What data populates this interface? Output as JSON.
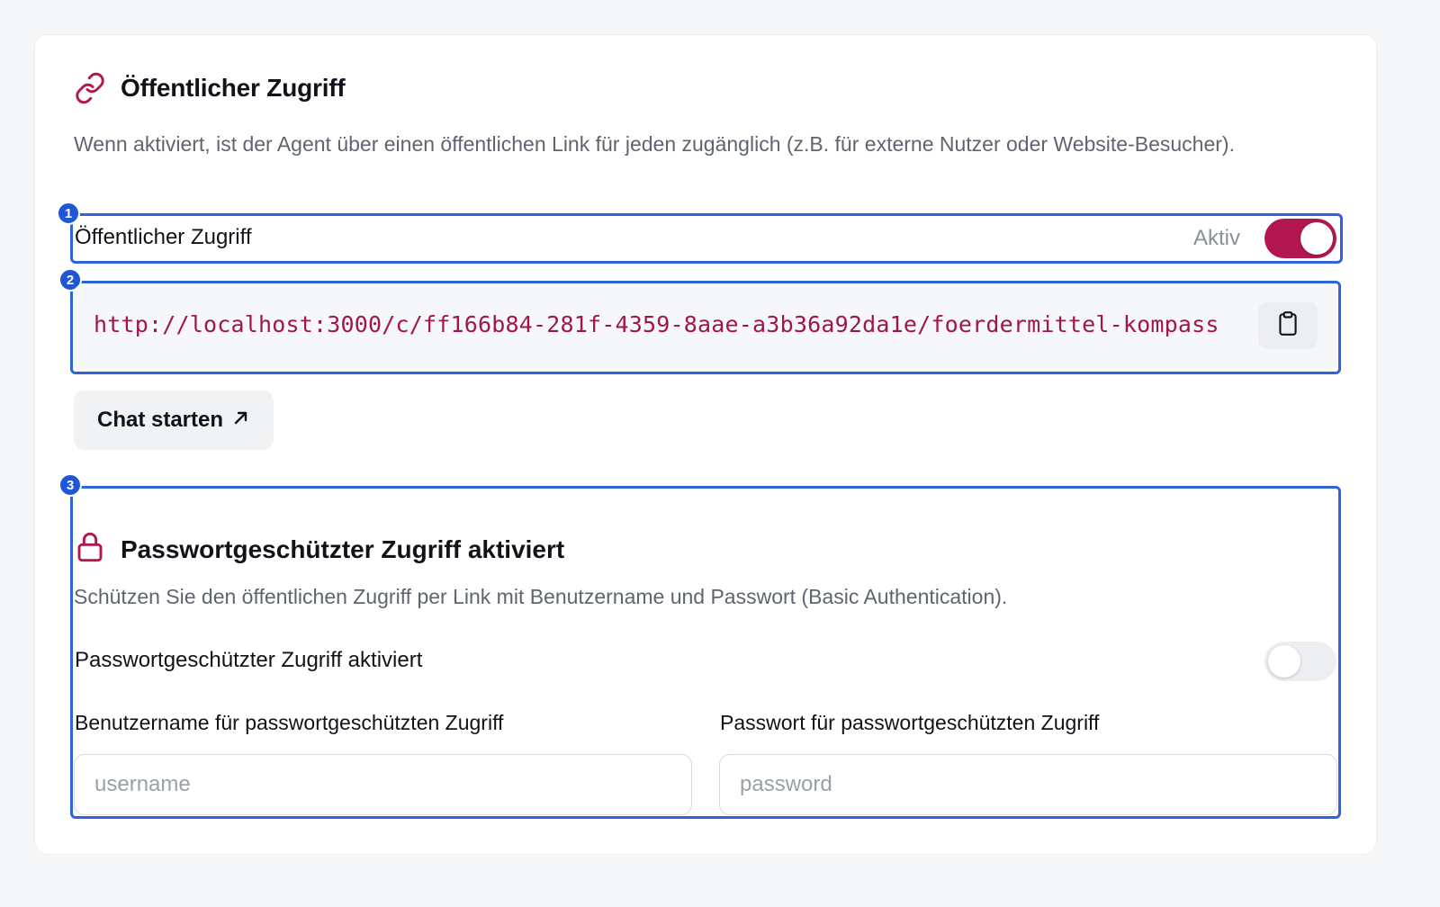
{
  "public_access": {
    "title": "Öffentlicher Zugriff",
    "description": "Wenn aktiviert, ist der Agent über einen öffentlichen Link für jeden zugänglich (z.B. für externe Nutzer oder Website-Besucher).",
    "toggle_label": "Öffentlicher Zugriff",
    "status_text": "Aktiv",
    "enabled": true,
    "icon": "link-icon"
  },
  "link": {
    "url": "http://localhost:3000/c/ff166b84-281f-4359-8aae-a3b36a92da1e/foerdermittel-kompass",
    "copy_icon": "clipboard-icon"
  },
  "chat_button": {
    "label": "Chat starten",
    "icon": "arrow-up-right-icon"
  },
  "annotations": {
    "badge_1": "1",
    "badge_2": "2",
    "badge_3": "3"
  },
  "password_access": {
    "title": "Passwortgeschützter Zugriff aktiviert",
    "description": "Schützen Sie den öffentlichen Zugriff per Link mit Benutzername und Passwort (Basic Authentication).",
    "toggle_label": "Passwortgeschützter Zugriff aktiviert",
    "enabled": false,
    "icon": "lock-icon",
    "username_label": "Benutzername für passwortgeschützten Zugriff",
    "username_placeholder": "username",
    "username_value": "",
    "password_label": "Passwort für passwortgeschützten Zugriff",
    "password_placeholder": "password",
    "password_value": ""
  },
  "colors": {
    "accent": "#b3174f",
    "link_text": "#a0164a",
    "highlight_border": "#2f63d9",
    "badge": "#1f56d8"
  }
}
